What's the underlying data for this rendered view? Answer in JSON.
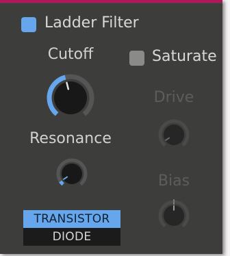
{
  "filter": {
    "enable_label": "Ladder Filter",
    "enabled": true
  },
  "cutoff": {
    "label": "Cutoff",
    "value": 0.45
  },
  "resonance": {
    "label": "Resonance",
    "value": 0.06
  },
  "saturate": {
    "label": "Saturate",
    "enabled": false
  },
  "drive": {
    "label": "Drive",
    "value": 0.06
  },
  "bias": {
    "label": "Bias",
    "value": 0.5
  },
  "mode": {
    "options": [
      "TRANSISTOR",
      "DIODE"
    ],
    "selected": "TRANSISTOR"
  },
  "colors": {
    "accent": "#65a6ec",
    "panel": "#3d3d3c",
    "frame": "#b0175a",
    "knob_track": "#555555",
    "disabled_text": "#5d5d5c"
  }
}
